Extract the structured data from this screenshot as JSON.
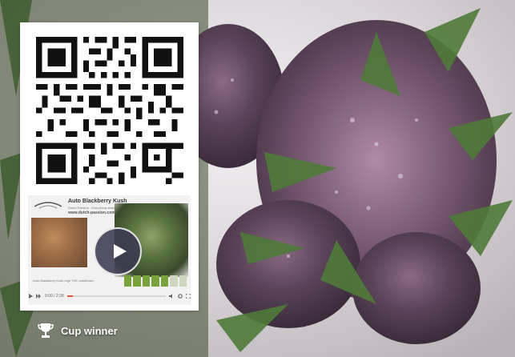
{
  "video": {
    "title": "Auto Blackberry Kush",
    "subtitle": "Dutch Passion - Everything starts with the seed",
    "url": "www.dutch-passion.com",
    "caption": "Auto Blackberry Kush high THC autoflower",
    "time": "0:00 / 2:28",
    "progress_fraction": 0.06,
    "meter_level": 5,
    "meter_total": 7
  },
  "badge": {
    "label": "Cup winner",
    "icon": "trophy-icon"
  },
  "colors": {
    "badge_text": "#ffffff",
    "play_button": "#3c3a50",
    "progress_accent": "#e05a3a"
  }
}
